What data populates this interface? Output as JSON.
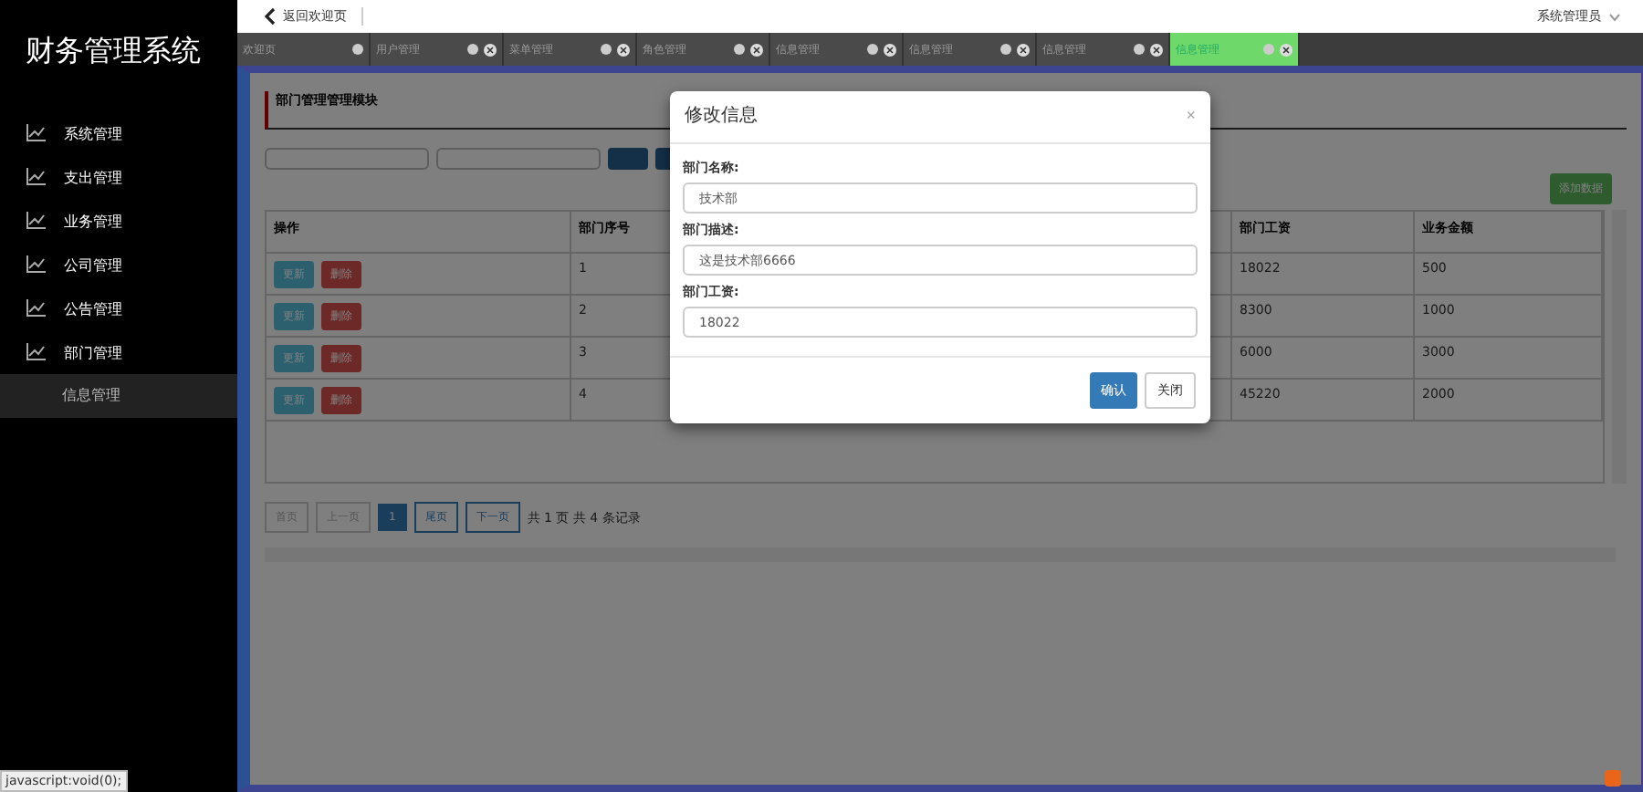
{
  "sidebar": {
    "title": "财务管理系统",
    "items": [
      {
        "label": "系统管理",
        "selected": false
      },
      {
        "label": "支出管理",
        "selected": false
      },
      {
        "label": "业务管理",
        "selected": false
      },
      {
        "label": "公司管理",
        "selected": false
      },
      {
        "label": "公告管理",
        "selected": false
      },
      {
        "label": "部门管理",
        "selected": false,
        "children": [
          {
            "label": "信息管理",
            "selected": true
          }
        ]
      }
    ]
  },
  "topbar": {
    "back_link": "返回欢迎页",
    "user_menu": "系统管理员"
  },
  "tabs": [
    {
      "label": "欢迎页",
      "closable": false,
      "selected": false
    },
    {
      "label": "用户管理",
      "closable": true,
      "selected": false
    },
    {
      "label": "菜单管理",
      "closable": true,
      "selected": false
    },
    {
      "label": "角色管理",
      "closable": true,
      "selected": false
    },
    {
      "label": "信息管理",
      "closable": true,
      "selected": false
    },
    {
      "label": "信息管理",
      "closable": true,
      "selected": false
    },
    {
      "label": "信息管理",
      "closable": true,
      "selected": false
    },
    {
      "label": "信息管理",
      "closable": true,
      "selected": true
    }
  ],
  "panel": {
    "title": "部门管理管理模块",
    "add_button": "添加数据",
    "table": {
      "columns": [
        "操作",
        "部门序号",
        "部门工资",
        "业务金额"
      ],
      "rows": [
        {
          "update": "更新",
          "delete": "删除",
          "id": "1",
          "salary": "18022",
          "amount": "500"
        },
        {
          "update": "更新",
          "delete": "删除",
          "id": "2",
          "salary": "8300",
          "amount": "1000"
        },
        {
          "update": "更新",
          "delete": "删除",
          "id": "3",
          "salary": "6000",
          "amount": "3000"
        },
        {
          "update": "更新",
          "delete": "删除",
          "id": "4",
          "salary": "45220",
          "amount": "2000"
        }
      ]
    },
    "pagination": {
      "pages": [
        {
          "label": "首页",
          "disabled": true,
          "selected": false
        },
        {
          "label": "上一页",
          "disabled": true,
          "selected": false
        },
        {
          "label": "1",
          "disabled": false,
          "selected": true
        },
        {
          "label": "尾页",
          "disabled": false,
          "selected": false
        },
        {
          "label": "下一页",
          "disabled": false,
          "selected": false
        }
      ],
      "summary": "共 1 页 共 4 条记录"
    }
  },
  "modal": {
    "title": "修改信息",
    "close": "×",
    "fields": [
      {
        "label": "部门名称:",
        "value": "技术部"
      },
      {
        "label": "部门描述:",
        "value": "这是技术部6666"
      },
      {
        "label": "部门工资:",
        "value": "18022"
      }
    ],
    "confirm": "确认",
    "cancel": "关闭"
  },
  "status_bar": "javascript:void(0);"
}
